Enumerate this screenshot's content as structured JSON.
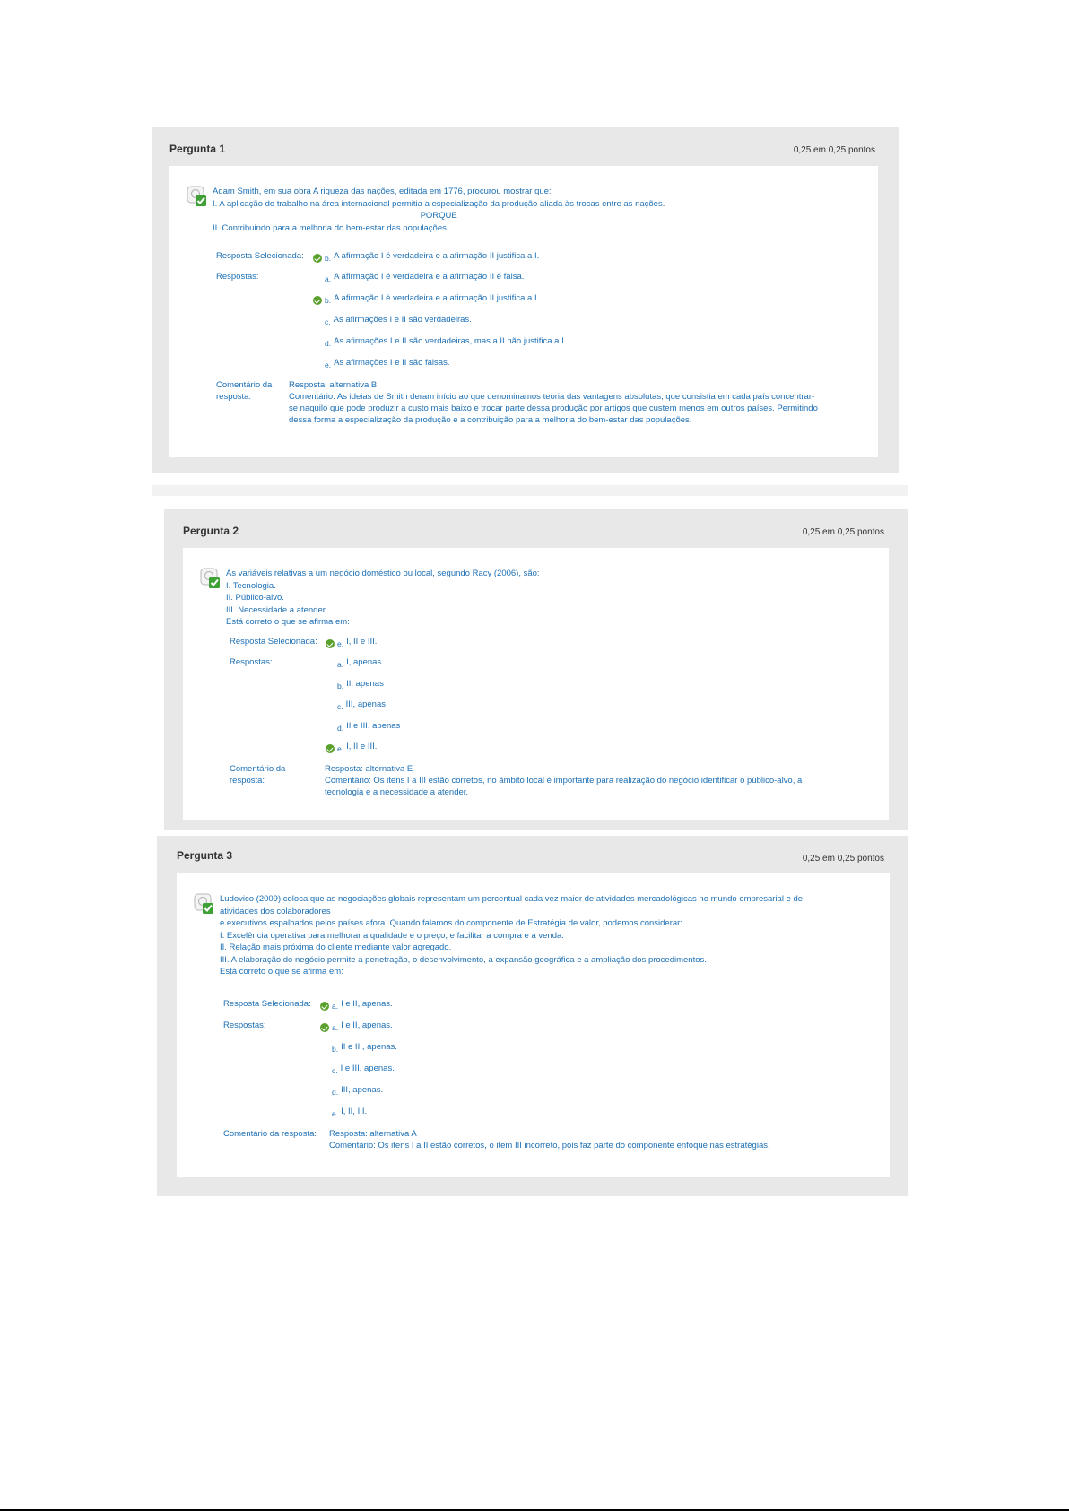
{
  "questions": [
    {
      "title": "Pergunta 1",
      "points": "0,25 em 0,25 pontos",
      "text_lines": [
        "Adam Smith, em sua obra A riqueza das nações, editada em 1776, procurou mostrar que:",
        "I. A aplicação do trabalho na área internacional permitia a especialização da produção aliada às trocas entre as nações.",
        "PORQUE",
        "II. Contribuindo para a melhoria do bem-estar das populações."
      ],
      "selected_label": "Resposta Selecionada:",
      "selected": {
        "letter": "b.",
        "text": "A afirmação I é verdadeira e a afirmação II justifica a I."
      },
      "answers_label": "Respostas:",
      "answers": [
        {
          "letter": "a.",
          "text": "A afirmação I é verdadeira e a afirmação II é falsa.",
          "correct": false
        },
        {
          "letter": "b.",
          "text": "A afirmação I é verdadeira e a afirmação II justifica a I.",
          "correct": true
        },
        {
          "letter": "c.",
          "text": "As afirmações I e II são verdadeiras.",
          "correct": false
        },
        {
          "letter": "d.",
          "text": "As afirmações I e II são verdadeiras, mas a II não justifica a I.",
          "correct": false
        },
        {
          "letter": "e.",
          "text": "As afirmações I e II são falsas.",
          "correct": false
        }
      ],
      "comment_label_1": "Comentário da",
      "comment_label_2": "resposta:",
      "comment_lines": [
        "Resposta: alternativa B",
        "Comentário: As ideias de Smith deram início ao que denominamos teoria das vantagens absolutas, que consistia em cada país concentrar-",
        "se naquilo que pode produzir a custo mais baixo e trocar parte dessa produção por artigos que custem menos em outros países. Permitindo",
        "dessa forma a especialização da produção e a contribuição para a melhoria do bem-estar das populações."
      ]
    },
    {
      "title": "Pergunta 2",
      "points": "0,25 em 0,25 pontos",
      "text_lines": [
        "As variáveis relativas a um negócio doméstico ou local, segundo Racy (2006), são:",
        "I. Tecnologia.",
        "II. Público-alvo.",
        "III. Necessidade a atender.",
        "Está correto o que se afirma em:"
      ],
      "selected_label": "Resposta Selecionada:",
      "selected": {
        "letter": "e.",
        "text": "I, II e III."
      },
      "answers_label": "Respostas:",
      "answers": [
        {
          "letter": "a.",
          "text": "I, apenas.",
          "correct": false
        },
        {
          "letter": "b.",
          "text": "II, apenas",
          "correct": false
        },
        {
          "letter": "c.",
          "text": "III, apenas",
          "correct": false
        },
        {
          "letter": "d.",
          "text": "II e III, apenas",
          "correct": false
        },
        {
          "letter": "e.",
          "text": "I, II e III.",
          "correct": true
        }
      ],
      "comment_label_1": "Comentário da",
      "comment_label_2": "resposta:",
      "comment_lines": [
        "Resposta: alternativa E",
        "Comentário: Os itens I a III estão corretos, no âmbito local é importante para realização do negócio identificar o público-alvo, a",
        "tecnologia e a necessidade a atender."
      ]
    },
    {
      "title": "Pergunta 3",
      "points": "0,25 em 0,25 pontos",
      "text_lines": [
        "Ludovico (2009) coloca que as negociações globais representam um percentual cada vez maior de atividades mercadológicas no mundo empresarial e de",
        "atividades dos colaboradores",
        "e executivos espalhados pelos países afora. Quando falamos do componente de Estratégia de valor, podemos considerar:",
        "I. Excelência operativa para melhorar a qualidade e o preço, e facilitar a compra e a venda.",
        "II. Relação mais próxima do cliente mediante valor agregado.",
        "III. A elaboração do negócio permite a penetração, o desenvolvimento, a expansão geográfica e a ampliação dos procedimentos.",
        "Está correto o que se afirma em:"
      ],
      "selected_label": "Resposta Selecionada:",
      "selected": {
        "letter": "a.",
        "text": "I e II, apenas."
      },
      "answers_label": "Respostas:",
      "answers": [
        {
          "letter": "a.",
          "text": "I e II, apenas.",
          "correct": true
        },
        {
          "letter": "b.",
          "text": "II e III, apenas.",
          "correct": false
        },
        {
          "letter": "c.",
          "text": "I e III, apenas.",
          "correct": false
        },
        {
          "letter": "d.",
          "text": "III, apenas.",
          "correct": false
        },
        {
          "letter": "e.",
          "text": "I, II, III.",
          "correct": false
        }
      ],
      "comment_label": "Comentário da resposta:",
      "comment_lines": [
        "Resposta: alternativa A",
        "Comentário: Os itens I a II estão corretos, o item III incorreto, pois faz parte do componente enfoque nas estratégias."
      ]
    }
  ],
  "colors": {
    "text_blue": "#1c6fb4",
    "check_green": "#5aa02c",
    "card_bg": "#e8e8e8"
  }
}
